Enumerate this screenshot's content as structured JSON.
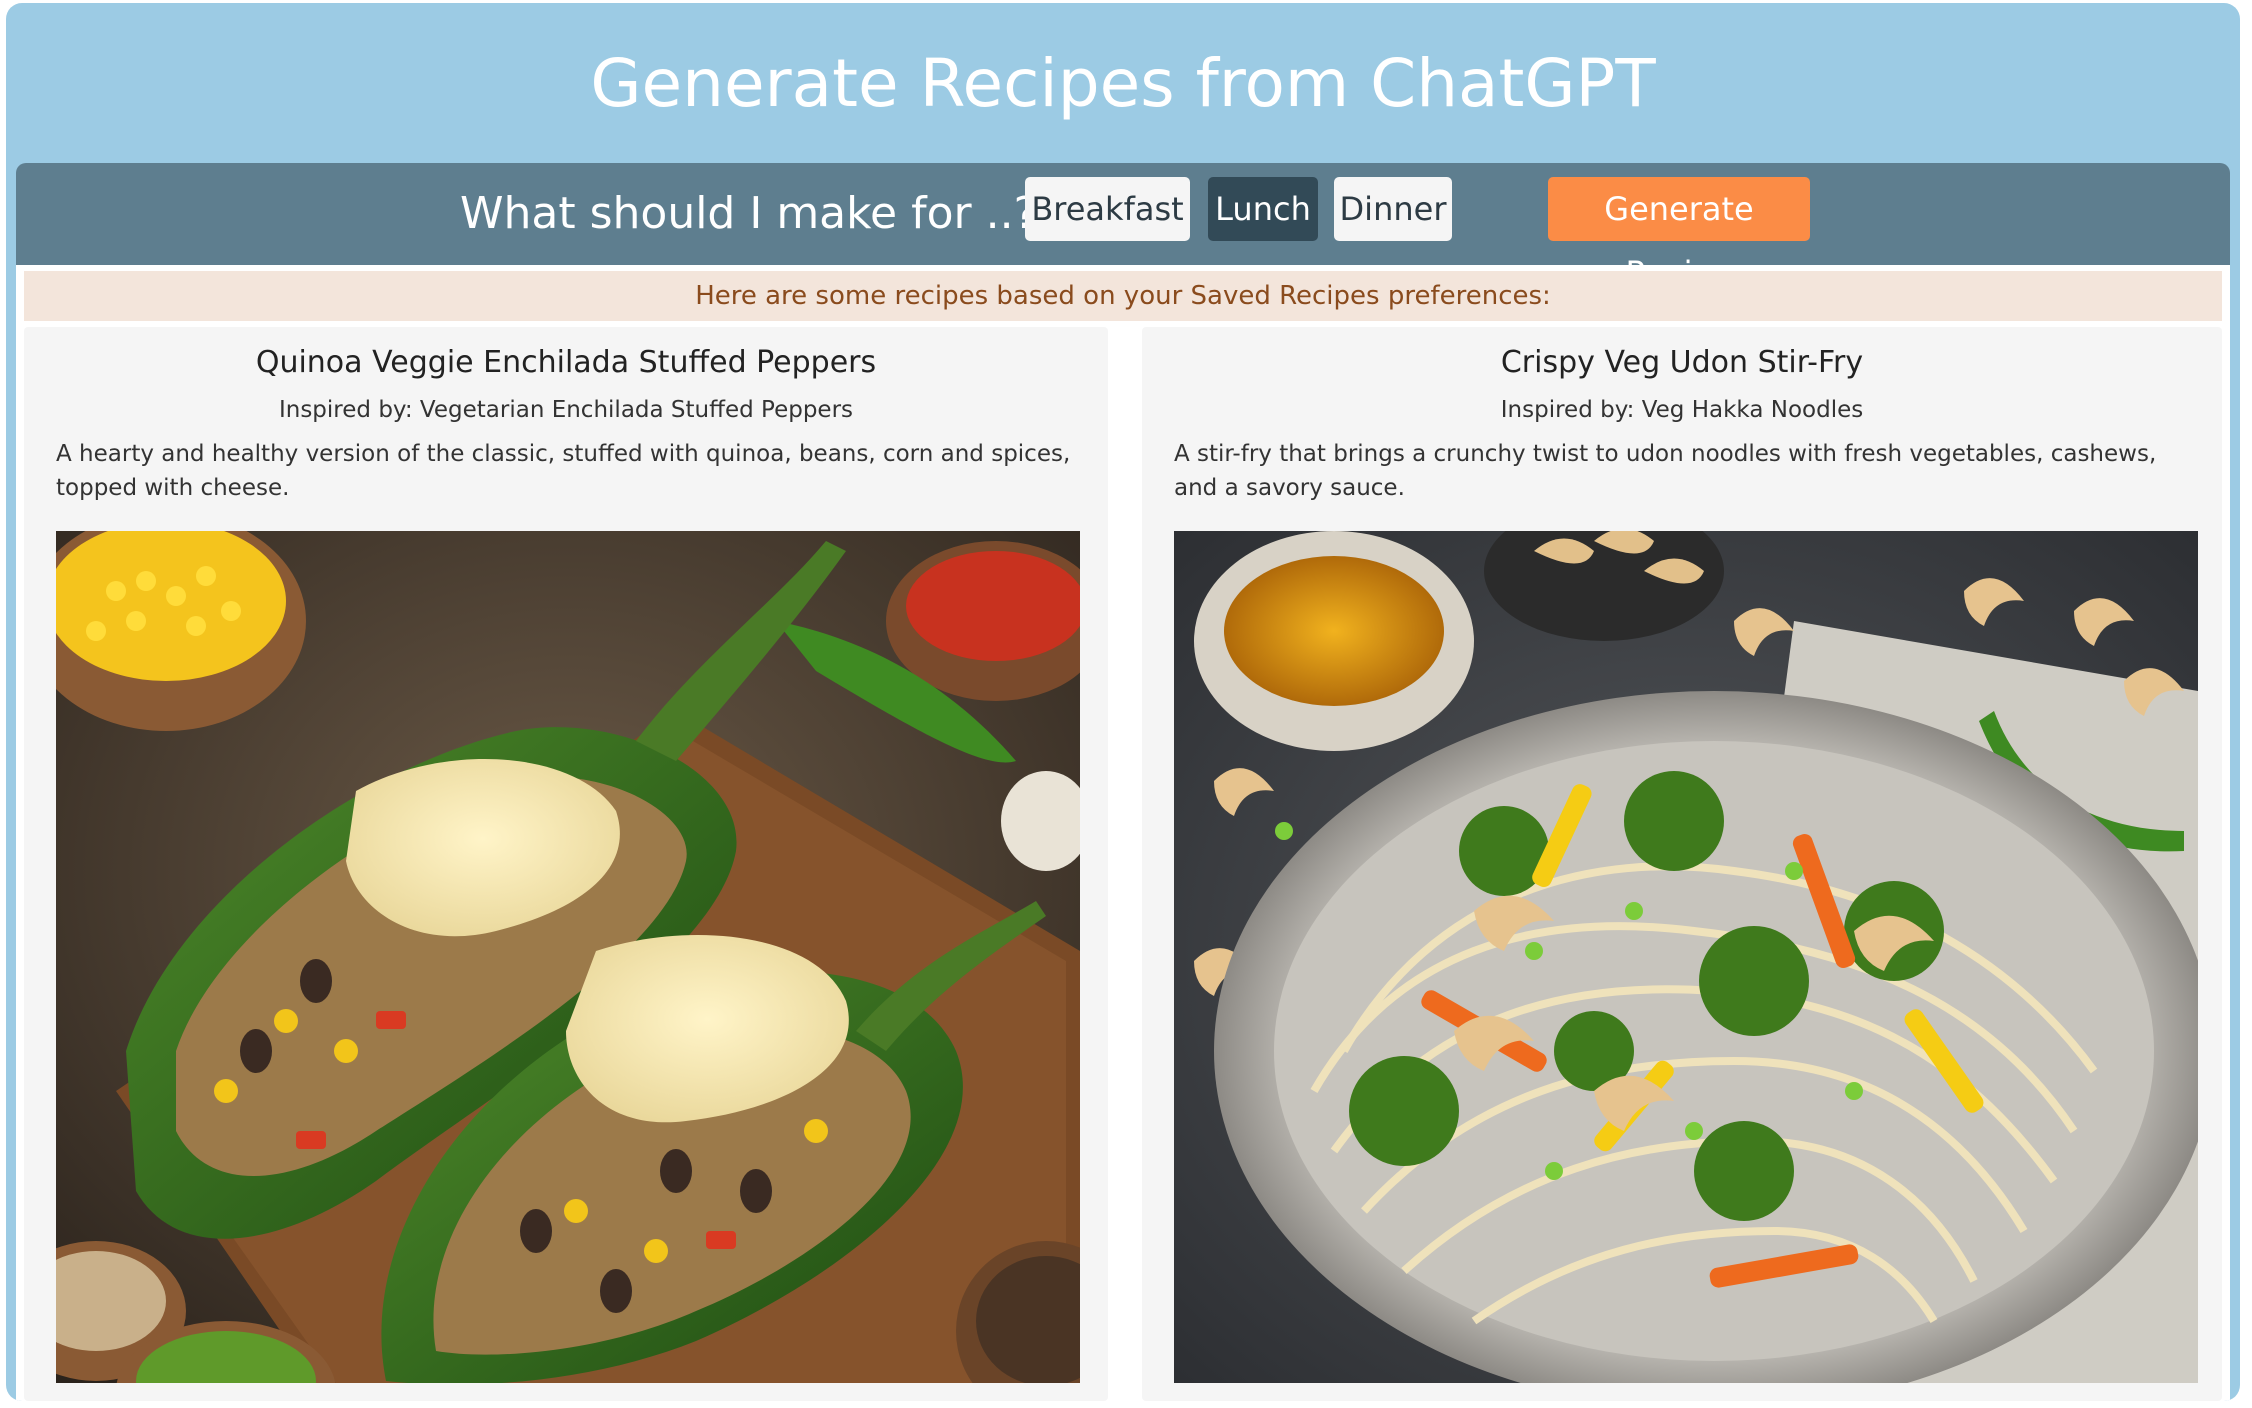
{
  "app": {
    "title": "Generate Recipes from ChatGPT"
  },
  "toolbar": {
    "question": "What should I make for ..?",
    "meals": [
      {
        "label": "Breakfast",
        "active": false
      },
      {
        "label": "Lunch",
        "active": true
      },
      {
        "label": "Dinner",
        "active": false
      }
    ],
    "generate_label": "Generate Recipe"
  },
  "banner": {
    "text": "Here are some recipes based on your Saved Recipes preferences:"
  },
  "recipes": [
    {
      "title": "Quinoa Veggie Enchilada Stuffed Peppers",
      "inspired": "Inspired by: Vegetarian Enchilada Stuffed Peppers",
      "description": "A hearty and healthy version of the classic, stuffed with quinoa, beans, corn and spices, topped with cheese."
    },
    {
      "title": "Crispy Veg Udon Stir-Fry",
      "inspired": "Inspired by: Veg Hakka Noodles",
      "description": "A stir-fry that brings a crunchy twist to udon noodles with fresh vegetables, cashews, and a savory sauce."
    }
  ],
  "colors": {
    "header_bg": "#9ccbe4",
    "toolbar_bg": "#5e7e8f",
    "active_meal": "#324a57",
    "generate_button": "#fb8c46",
    "banner_bg": "#f3e5db",
    "banner_text": "#8a4b1d"
  }
}
